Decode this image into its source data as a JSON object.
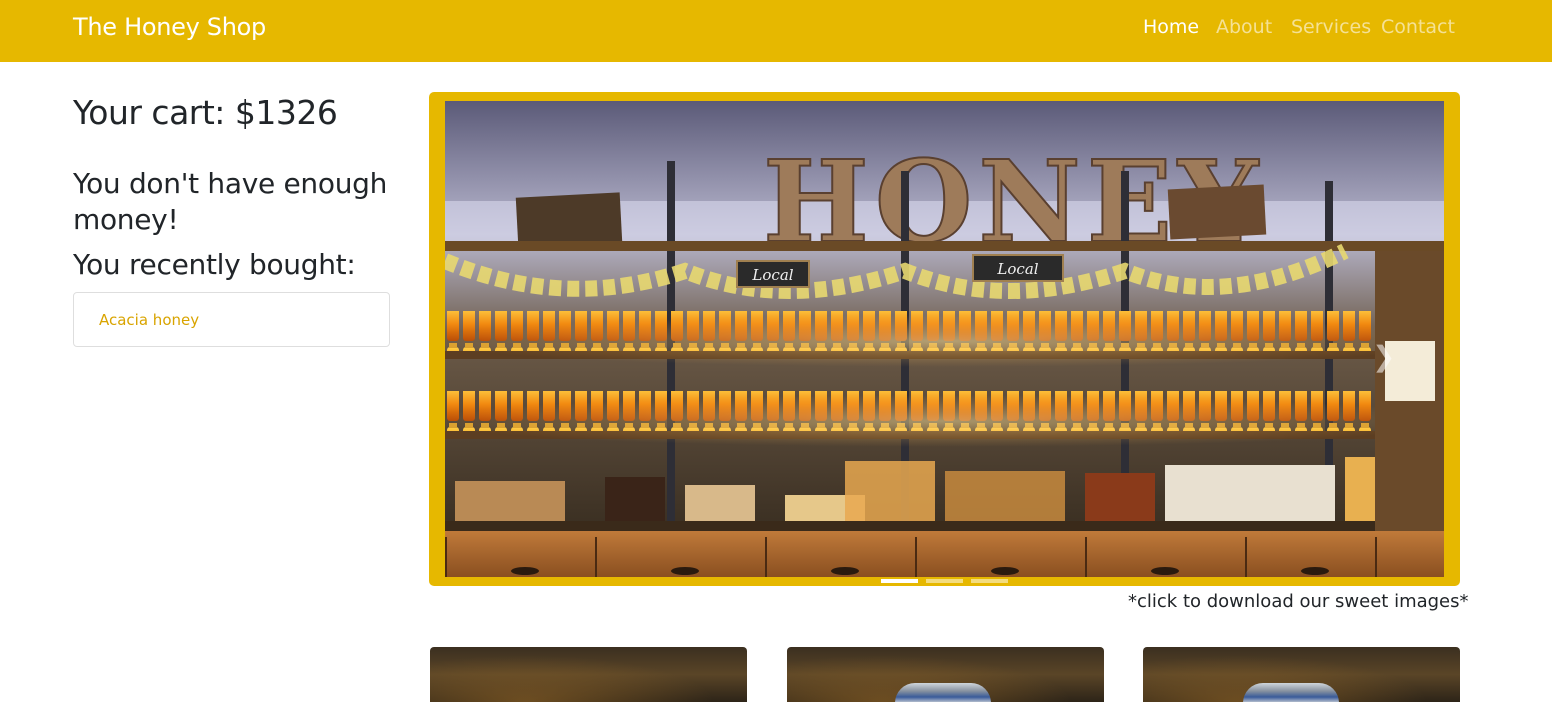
{
  "navbar": {
    "brand": "The Honey Shop",
    "links": [
      {
        "label": "Home",
        "active": true
      },
      {
        "label": "About",
        "active": false
      },
      {
        "label": "Services",
        "active": false
      },
      {
        "label": "Contact",
        "active": false
      }
    ]
  },
  "sidebar": {
    "cart_total": "Your cart: $1326",
    "warning": "You don't have enough money!",
    "recent_heading": "You recently bought:",
    "recent_items": [
      "Acacia honey"
    ]
  },
  "carousel": {
    "sign_text": "HONEY",
    "shelf_signs": [
      "Local",
      "Local"
    ],
    "slide_count": 3,
    "active_slide": 1,
    "caption": "*click to download our sweet images*"
  },
  "colors": {
    "brand": "#e6b800",
    "link_accent": "#d9a400"
  },
  "icons": {
    "next": "chevron-right-icon"
  }
}
